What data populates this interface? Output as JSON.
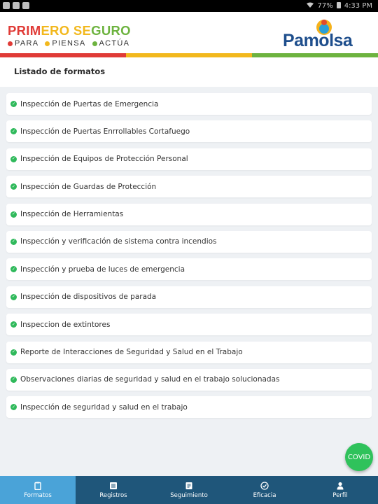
{
  "status_bar": {
    "battery": "77%",
    "time": "4:33 PM"
  },
  "header": {
    "brand_title_part1": "PRIM",
    "brand_title_part2": "ERO SE",
    "brand_title_part3": "GURO",
    "brand_words": [
      "PARA",
      "PIENSA",
      "ACTÚA"
    ],
    "brand_colors": [
      "#e03b37",
      "#f2b81d",
      "#6db33f"
    ],
    "company": "Pamolsa"
  },
  "color_bar": [
    "#e03b37",
    "#f2b81d",
    "#6db33f"
  ],
  "page_title": "Listado de formatos",
  "formats": [
    "Inspección de Puertas de Emergencia",
    "Inspección de Puertas Enrrollables Cortafuego",
    "Inspección de Equipos de Protección Personal",
    "Inspección de Guardas de Protección",
    "Inspección de Herramientas",
    "Inspección y verificación de sistema contra incendios",
    "Inspección y prueba de luces de emergencia",
    "Inspección de dispositivos de parada",
    "Inspeccion de extintores",
    "Reporte de Interacciones de Seguridad y Salud en el Trabajo",
    "Observaciones diarias de seguridad y salud en el trabajo solucionadas",
    "Inspección de seguridad y salud en el trabajo"
  ],
  "covid_button": "COVID",
  "nav": [
    {
      "label": "Formatos",
      "icon": "clipboard-icon",
      "active": true
    },
    {
      "label": "Registros",
      "icon": "list-icon",
      "active": false
    },
    {
      "label": "Seguimiento",
      "icon": "document-icon",
      "active": false
    },
    {
      "label": "Eficacia",
      "icon": "check-circle-icon",
      "active": false
    },
    {
      "label": "Perfil",
      "icon": "user-icon",
      "active": false
    }
  ],
  "colors": {
    "nav_bg": "#1f567a",
    "nav_active": "#4aa3d8",
    "check_green": "#2fb95b",
    "covid_green": "#2fc25b"
  }
}
